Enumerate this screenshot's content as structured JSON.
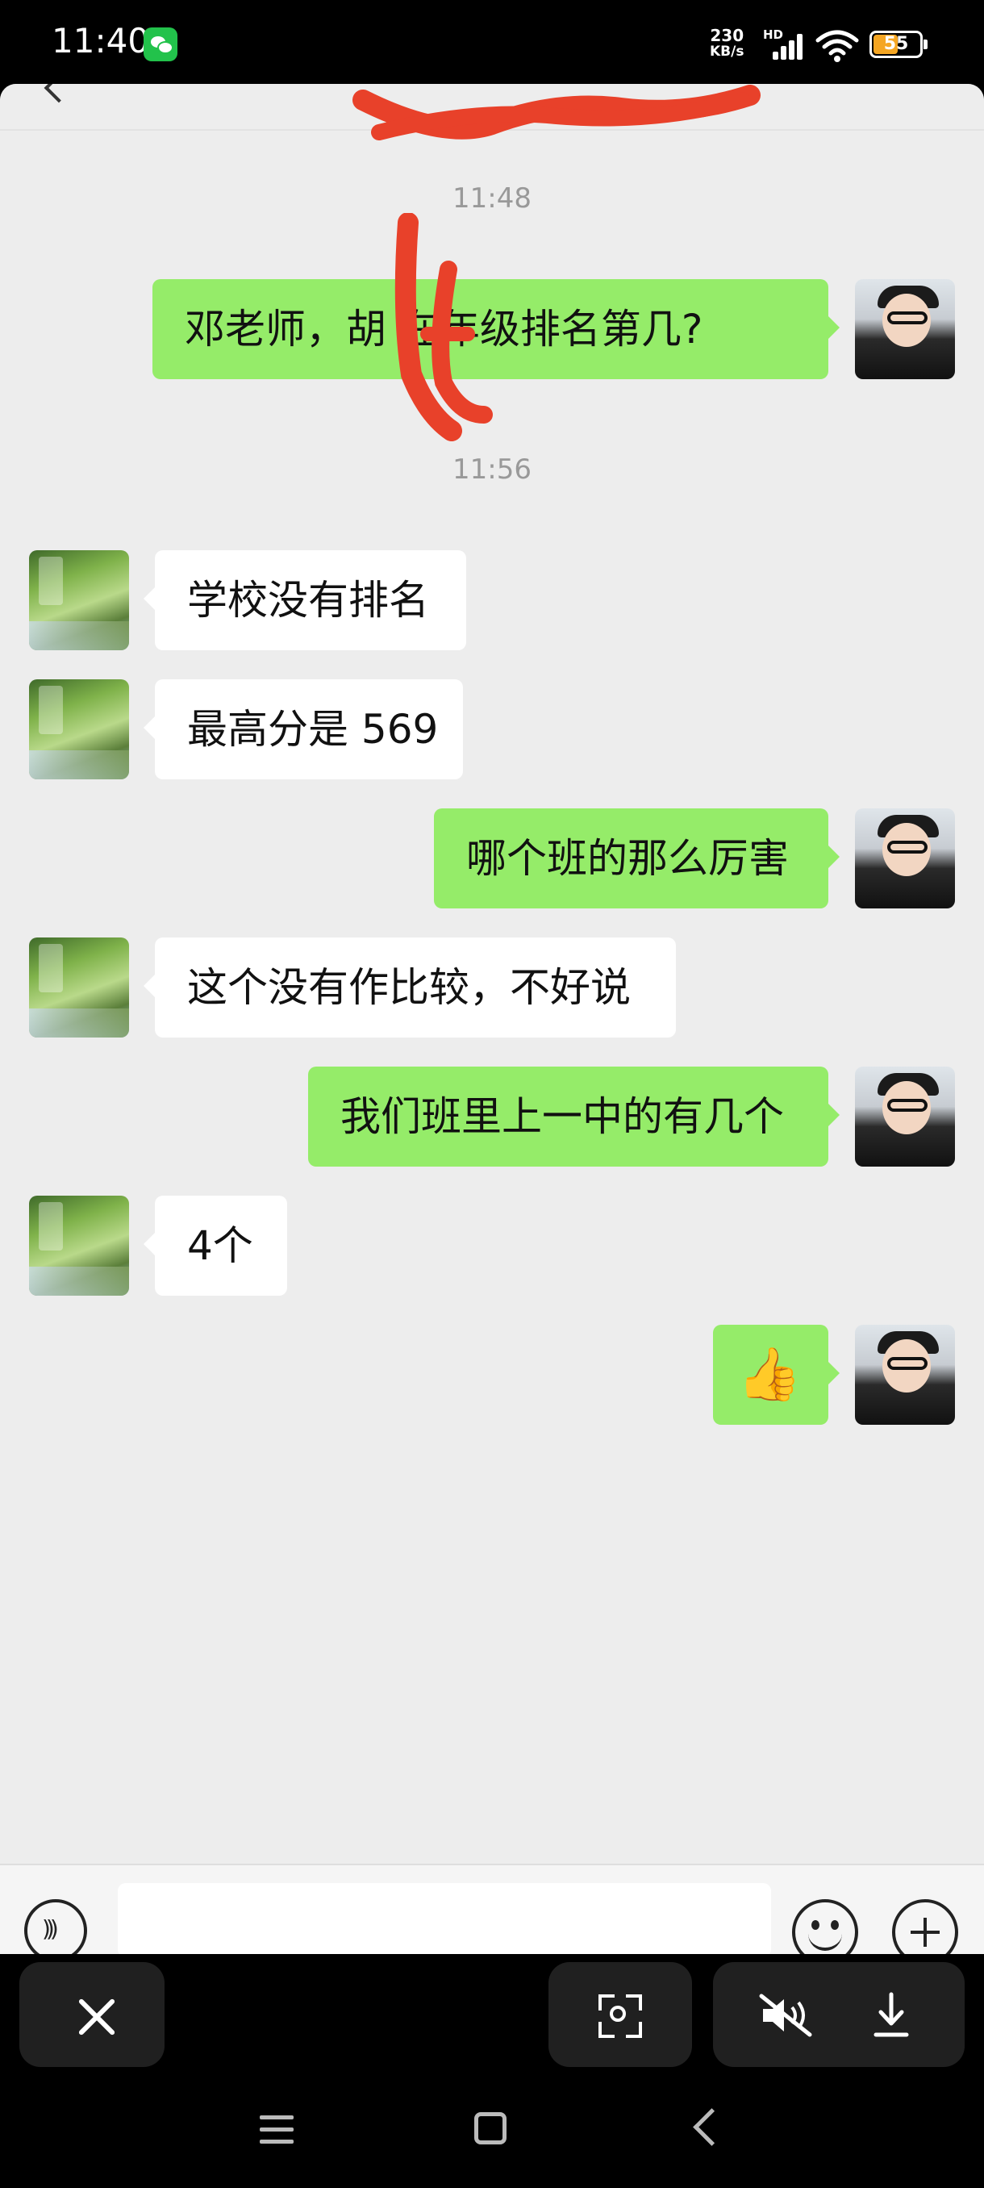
{
  "status_bar": {
    "time": "11:40",
    "network_speed_value": "230",
    "network_speed_unit": "KB/s",
    "hd_label": "HD",
    "battery_level": "55",
    "app_notification_icon": "wechat-icon"
  },
  "chat": {
    "timestamps": [
      "11:48",
      "11:56"
    ],
    "messages": [
      {
        "side": "me",
        "text": "邓老师，胡 在年级排名第几?",
        "note": "partially obscured by red scribble"
      },
      {
        "side": "teacher",
        "text": "学校没有排名"
      },
      {
        "side": "teacher",
        "text": "最高分是 569"
      },
      {
        "side": "me",
        "text": "哪个班的那么厉害"
      },
      {
        "side": "teacher",
        "text": "这个没有作比较，不好说"
      },
      {
        "side": "me",
        "text": "我们班里上一中的有几个"
      },
      {
        "side": "teacher",
        "text": "4个"
      },
      {
        "side": "me",
        "text": "👍",
        "kind": "emoji"
      }
    ]
  },
  "input_bar": {
    "placeholder": ""
  },
  "colors": {
    "my_bubble": "#95ec69",
    "their_bubble": "#ffffff",
    "chat_background": "#ededed",
    "redaction_red": "#e8412a"
  },
  "overlay_buttons": {
    "close": "close-icon",
    "scan": "scan-search-icon",
    "mute": "mute-icon",
    "download": "download-icon"
  }
}
